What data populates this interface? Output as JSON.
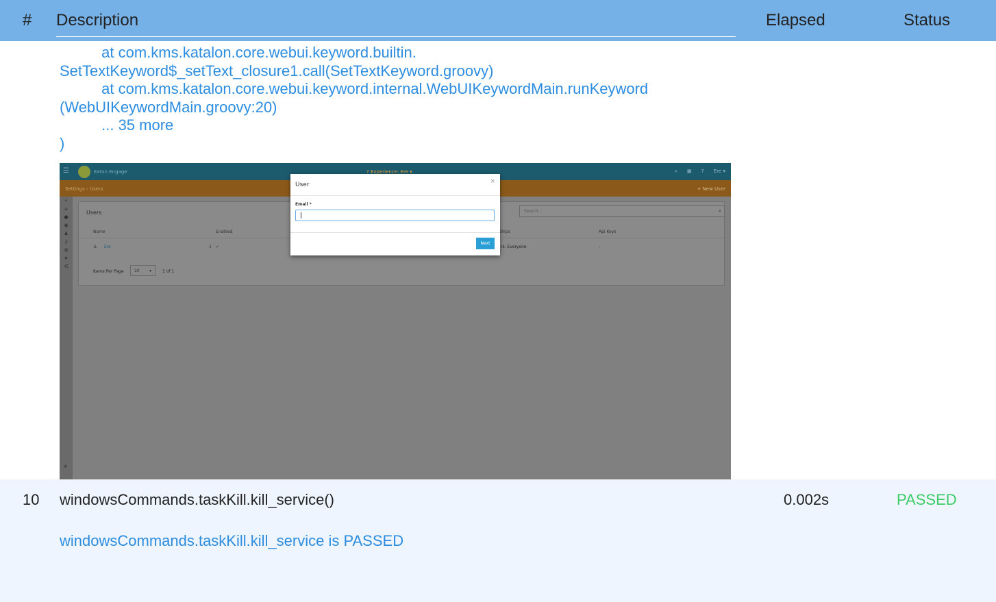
{
  "header": {
    "num": "#",
    "description": "Description",
    "elapsed": "Elapsed",
    "status": "Status"
  },
  "trace": {
    "line1": "          at com.kms.katalon.core.webui.keyword.builtin.",
    "line2": "SetTextKeyword$_setText_closure1.call(SetTextKeyword.groovy)",
    "line3": "          at com.kms.katalon.core.webui.keyword.internal.WebUIKeywordMain.runKeyword",
    "line4": "(WebUIKeywordMain.groovy:20)",
    "line5": "          ... 35 more",
    "line6": ")"
  },
  "screenshot": {
    "app_name": "Exton Engage",
    "experience": "? Experience: Ere ▾",
    "top_icons": [
      "search-icon",
      "grid-icon",
      "help-icon"
    ],
    "user_menu": "Ere ▾",
    "breadcrumb": "Settings  ›  Users",
    "new_user": "+ New User",
    "panel_title": "Users",
    "search_placeholder": "Search...",
    "columns": {
      "name": "Name",
      "enabled": "Enabled",
      "memberships": "erships",
      "api_keys": "Api Keys"
    },
    "row": {
      "name": "Ere",
      "memberships": "rs, Everyone",
      "api_keys": "-"
    },
    "items_per_page_label": "Items Per Page",
    "items_per_page_value": "10",
    "page_of": "1 of 1",
    "modal": {
      "title": "User",
      "close": "×",
      "email_label": "Email *",
      "email_value": "",
      "next_button": "Next"
    }
  },
  "step": {
    "num": "10",
    "description": "windowsCommands.taskKill.kill_service()",
    "elapsed": "0.002s",
    "status": "PASSED",
    "status_color": "#3ccc68",
    "message": "windowsCommands.taskKill.kill_service is PASSED"
  },
  "colors": {
    "header_bg": "#75b0e6",
    "link_blue": "#2d8de0",
    "row_bg": "#eef5fe"
  }
}
